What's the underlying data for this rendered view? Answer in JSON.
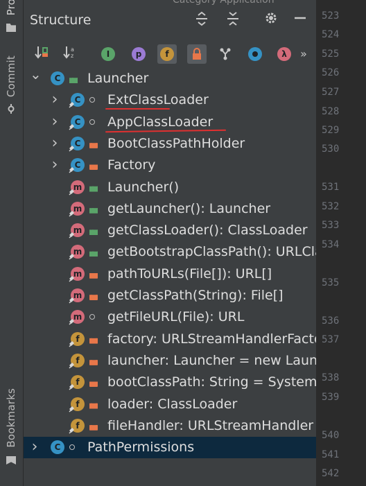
{
  "side_tabs": {
    "project": "Pro",
    "commit": "Commit",
    "bookmarks": "Bookmarks"
  },
  "panel": {
    "title": "Structure",
    "peek_text": "Category Application",
    "title_buttons": [
      "expand-all-icon",
      "collapse-all-icon",
      "gear-icon",
      "minimize-icon"
    ],
    "toolbar": {
      "sort_visibility": "sort-by-visibility-icon",
      "sort_alpha": "sort-alphabetically-icon",
      "inherited": "I",
      "properties": "p",
      "fields": "f",
      "non_public": "non-public-lock-icon",
      "hierarchy": "hierarchy-icon",
      "anonymous": "anonymous-class-icon",
      "lambdas": "λ",
      "more": "»"
    }
  },
  "tree": {
    "rows": [
      {
        "kind": "C",
        "vis": "unlock",
        "label": "Launcher",
        "expand": "v"
      },
      {
        "kind": "C",
        "vis": "pkg",
        "label": "ExtClassLoader",
        "expand": ">"
      },
      {
        "kind": "C",
        "vis": "pkg",
        "label": "AppClassLoader",
        "expand": ">"
      },
      {
        "kind": "C",
        "vis": "lock",
        "label": "BootClassPathHolder",
        "expand": ">"
      },
      {
        "kind": "C",
        "vis": "lock",
        "label": "Factory",
        "expand": ">"
      },
      {
        "kind": "m",
        "vis": "unlock",
        "label": "Launcher()"
      },
      {
        "kind": "m",
        "vis": "unlock",
        "label": "getLauncher(): Launcher"
      },
      {
        "kind": "m",
        "vis": "unlock",
        "label": "getClassLoader(): ClassLoader"
      },
      {
        "kind": "m",
        "vis": "unlock",
        "label": "getBootstrapClassPath(): URLCla"
      },
      {
        "kind": "m",
        "vis": "lock",
        "label": "pathToURLs(File[]): URL[]"
      },
      {
        "kind": "m",
        "vis": "lock",
        "label": "getClassPath(String): File[]"
      },
      {
        "kind": "m",
        "vis": "pkg",
        "label": "getFileURL(File): URL"
      },
      {
        "kind": "f",
        "vis": "lock",
        "label": "factory: URLStreamHandlerFacto"
      },
      {
        "kind": "f",
        "vis": "lock",
        "label": "launcher: Launcher = new Launc"
      },
      {
        "kind": "f",
        "vis": "lock",
        "label": "bootClassPath: String = System"
      },
      {
        "kind": "f",
        "vis": "lock",
        "label": "loader: ClassLoader"
      },
      {
        "kind": "f",
        "vis": "lock",
        "label": "fileHandler: URLStreamHandler"
      },
      {
        "kind": "C",
        "vis": "pkg",
        "label": "PathPermissions",
        "expand": ">"
      }
    ]
  },
  "line_numbers": [
    "523",
    "524",
    "525",
    "526",
    "527",
    "528",
    "529",
    "530",
    "531",
    "532",
    "533",
    "534",
    "535",
    "536",
    "537",
    "538",
    "539",
    "540",
    "541",
    "542"
  ],
  "colors": {
    "panel_bg": "#3c3f41",
    "selected_row": "#0d293e",
    "annotation_red": "#e03030",
    "class_icon": "#3592c4",
    "method_icon": "#d46b7a",
    "field_icon": "#c4943b"
  }
}
